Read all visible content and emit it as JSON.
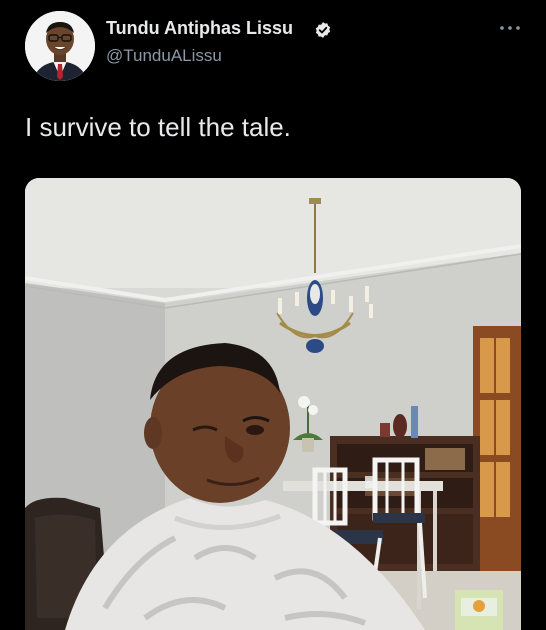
{
  "tweet": {
    "author": {
      "name": "Tundu Antiphas Lissu",
      "handle": "@TunduALissu",
      "verified": true,
      "avatar_icon": "profile-photo"
    },
    "text": "I survive to tell the tale.",
    "more_icon": "more-options-icon",
    "media": {
      "type": "photo"
    }
  },
  "colors": {
    "background": "#000000",
    "text_primary": "#e7e9ea",
    "text_secondary": "#8b98a5",
    "verified_badge": "#e7e9ea"
  }
}
